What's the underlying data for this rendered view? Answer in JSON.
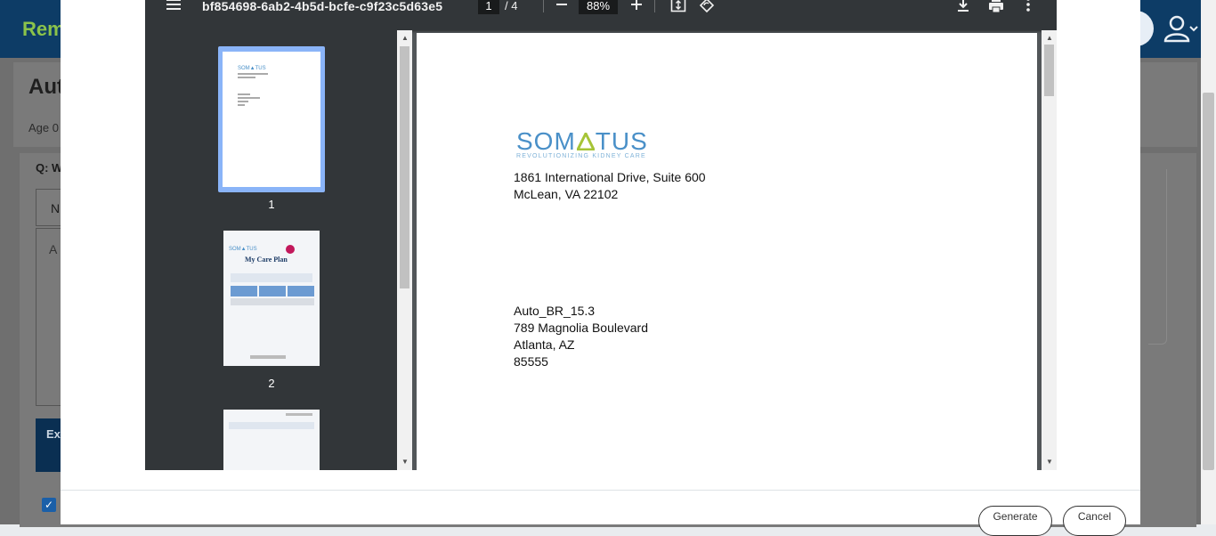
{
  "background": {
    "brand": "Rem",
    "title": "Aut",
    "subtitle": "Age 0",
    "question": "Q: W",
    "box1": "N",
    "box2": "A",
    "panel_label": "Ex"
  },
  "pdf": {
    "filename": "bf854698-6ab2-4b5d-bcfe-c9f23c5d63e5",
    "current_page": "1",
    "page_total": "/  4",
    "zoom": "88%",
    "thumbnails": [
      {
        "label": "1",
        "selected": true
      },
      {
        "label": "2",
        "selected": false
      },
      {
        "label": "",
        "selected": false
      }
    ],
    "logo": {
      "word_left": "SOM",
      "word_right": "TUS",
      "tagline": "REVOLUTIONIZING KIDNEY CARE"
    },
    "sender": [
      "1861 International Drive, Suite 600",
      "McLean, VA 22102"
    ],
    "recipient": [
      "Auto_BR_15.3",
      "789 Magnolia Boulevard",
      "Atlanta, AZ",
      "85555"
    ]
  },
  "footer": {
    "generate": "Generate",
    "cancel": "Cancel"
  },
  "colors": {
    "toolbar": "#323639",
    "viewer_bg": "#525659",
    "logo_blue": "#4a90c8",
    "logo_green": "#a6c437",
    "selected_thumb": "#8ab4f8"
  }
}
